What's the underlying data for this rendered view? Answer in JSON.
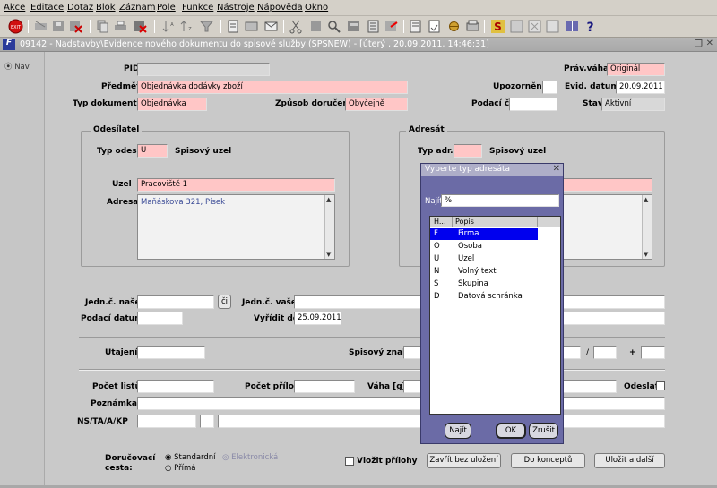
{
  "menu": [
    "Akce",
    "Editace",
    "Dotaz",
    "Blok",
    "Záznam",
    "Pole",
    "Funkce",
    "Nástroje",
    "Nápověda",
    "Okno"
  ],
  "window": {
    "title": "09142 - Nadstavby\\Evidence nového dokumentu do spisové služby (SPSNEW) - [úterý , 20.09.2011, 14:46:31]"
  },
  "side": {
    "nav_label": "Nav"
  },
  "fields": {
    "pid": {
      "label": "PID",
      "value": ""
    },
    "predmet": {
      "label": "Předmět",
      "value": "Objednávka dodávky zboží"
    },
    "typ_dokumentu": {
      "label": "Typ dokumentu",
      "value": "Objednávka"
    },
    "zpusob_doruceni": {
      "label": "Způsob doručení",
      "value": "Obyčejně"
    },
    "prav_vaha": {
      "label": "Práv.váha",
      "value": "Originál"
    },
    "upozorneni": {
      "label": "Upozornění",
      "value": ""
    },
    "evid_datum": {
      "label": "Evid. datum",
      "value": "20.09.2011"
    },
    "podaci_c": {
      "label": "Podací č.",
      "value": ""
    },
    "stav": {
      "label": "Stav",
      "value": "Aktivní"
    }
  },
  "odesilatel": {
    "title": "Odesílatel",
    "typ_label": "Typ odes.",
    "typ_value": "U",
    "typ_desc": "Spisový uzel",
    "uzel_label": "Uzel",
    "uzel_value": "Pracoviště 1",
    "adresa_label": "Adresa",
    "adresa_value": "Maňáskova 321, Písek"
  },
  "adresat": {
    "title": "Adresát",
    "typ_label": "Typ adr.",
    "typ_value": "",
    "typ_desc": "Spisový uzel"
  },
  "lower": {
    "jednc_nase": "Jedn.č. naše",
    "ci_btn": "či",
    "jednc_vase": "Jedn.č. vaše",
    "podaci_datum": "Podací datum",
    "vyridit_do": "Vyřídit do",
    "vyridit_do_value": "25.09.2011",
    "utajeni": "Utajení",
    "spisovy_znak": "Spisový znak",
    "slash": "/",
    "plus": "+",
    "pocet_listu": "Počet listů",
    "pocet_priloh": "Počet příloh",
    "vaha": "Váha [g]",
    "odeslat": "Odeslat",
    "poznamka": "Poznámka",
    "ns": "NS/TA/A/KP"
  },
  "delivery": {
    "label_line1": "Doručovací",
    "label_line2": "cesta:",
    "opt_standard": "Standardní",
    "opt_elektronicka": "Elektronická",
    "opt_prima": "Přímá",
    "vlozit_prilohy": "Vložit přílohy"
  },
  "buttons": {
    "zavrit": "Zavřít bez uložení",
    "do_konceptu": "Do konceptů",
    "ulozit": "Uložit a další"
  },
  "dialog": {
    "title": "Vyberte typ adresáta",
    "search_label": "Najít",
    "search_value": "%",
    "col_h": "H...",
    "col_popis": "Popis",
    "rows": [
      {
        "code": "F",
        "desc": "Firma"
      },
      {
        "code": "O",
        "desc": "Osoba"
      },
      {
        "code": "U",
        "desc": "Uzel"
      },
      {
        "code": "N",
        "desc": "Volný text"
      },
      {
        "code": "S",
        "desc": "Skupina"
      },
      {
        "code": "D",
        "desc": "Datová schránka"
      }
    ],
    "btn_najit": "Najít",
    "btn_ok": "OK",
    "btn_zrusit": "Zrušit"
  },
  "colors": {
    "required": "#ffc6c6",
    "selection": "#0000ee",
    "dialog": "#6b6ba6"
  }
}
